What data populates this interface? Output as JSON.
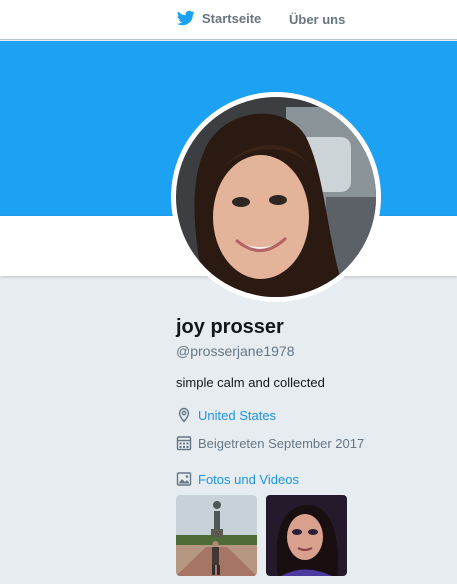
{
  "nav": {
    "home_label": "Startseite",
    "about_label": "Über uns",
    "logo_icon": "twitter-bird-icon"
  },
  "profile": {
    "name": "joy prosser",
    "handle": "@prosserjane1978",
    "bio": "simple calm and collected",
    "location": "United States",
    "joined": "Beigetreten September 2017",
    "location_icon": "location-pin-icon",
    "calendar_icon": "calendar-icon"
  },
  "media": {
    "label": "Fotos und Videos",
    "icon": "photo-icon",
    "thumbnails": [
      "photo-thumbnail-1",
      "photo-thumbnail-2"
    ]
  },
  "colors": {
    "banner": "#1da1f2",
    "page_background": "#e6ecf0",
    "link": "#1b95e0",
    "muted_text": "#657786"
  }
}
